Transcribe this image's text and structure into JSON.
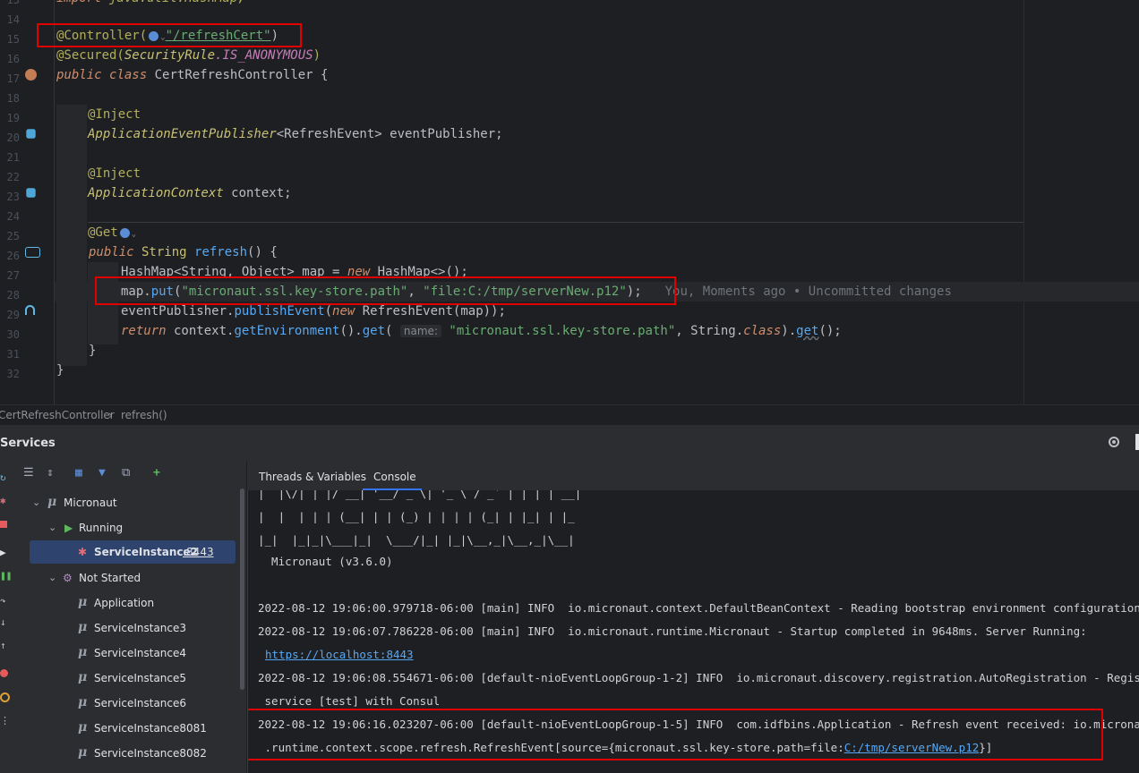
{
  "editor": {
    "line_numbers": [
      "13",
      "14",
      "15",
      "16",
      "17",
      "18",
      "19",
      "20",
      "21",
      "22",
      "23",
      "24",
      "25",
      "26",
      "27",
      "28",
      "29",
      "30",
      "31",
      "32"
    ],
    "top_partial": "import java.util.HashMap;",
    "l14_annotation": "@Controller(",
    "l14_path": "\"/refreshCert\"",
    "l14_close": ")",
    "l15_annotation": "@Secured(",
    "l15_rule": "SecurityRule",
    "l15_const": ".IS_ANONYMOUS",
    "l15_close": ")",
    "l16_public": "public",
    "l16_class": "class",
    "l16_name": "CertRefreshController {",
    "l18": "@Inject",
    "l19_type": "ApplicationEventPublisher",
    "l19_generic": "<RefreshEvent>",
    "l19_field": " eventPublisher;",
    "l21": "@Inject",
    "l22_type": "ApplicationContext",
    "l22_field": " context;",
    "l24": "@Get",
    "l25_public": "public",
    "l25_type": " String ",
    "l25_method": "refresh",
    "l25_rest": "() {",
    "l26_type": "HashMap<String, Object>",
    "l26_var": " map = ",
    "l26_new": "new",
    "l26_ctor": " HashMap",
    "l26_rest": "<>();",
    "l27_map": "map.",
    "l27_put": "put",
    "l27_key": "\"micronaut.ssl.key-store.path\"",
    "l27_sep": ", ",
    "l27_val": "\"file:C:/tmp/serverNew.p12\"",
    "l27_end": ");",
    "l27_blame": "You, Moments ago • Uncommitted changes",
    "l28_obj": "eventPublisher.",
    "l28_method": "publishEvent",
    "l28_open": "(",
    "l28_new": "new",
    "l28_rest": " RefreshEvent(map));",
    "l29_return": "return",
    "l29_ctx": " context.",
    "l29_getenv": "getEnvironment",
    "l29_mid": "().",
    "l29_get": "get",
    "l29_open": "( ",
    "l29_hint": "name:",
    "l29_key": " \"micronaut.ssl.key-store.path\"",
    "l29_sep": ", String.",
    "l29_class": "class",
    "l29_dot": ").",
    "l29_get2": "get",
    "l29_end": "();",
    "l30": "}",
    "l31": "}"
  },
  "breadcrumb": {
    "class_name": "CertRefreshController",
    "separator": "›",
    "method": "refresh()"
  },
  "services": {
    "title": "Services",
    "tree": {
      "micronaut": "Micronaut",
      "running": "Running",
      "selected_instance": "ServiceInstance2",
      "selected_port": ":8443",
      "not_started": "Not Started",
      "instances": [
        "Application",
        "ServiceInstance3",
        "ServiceInstance4",
        "ServiceInstance5",
        "ServiceInstance6",
        "ServiceInstance8081",
        "ServiceInstance8082"
      ]
    }
  },
  "console": {
    "tabs": [
      "Threads & Variables",
      "Console"
    ],
    "active_tab": "Console",
    "banner": [
      "|  |\\/| | |/ __| '__/ _ \\| '_ \\ / _` | | | | __|",
      "|  |  | | | (__| | | (_) | | | | (_| | |_| | |_",
      "|_|  |_|_|\\___|_|  \\___/|_| |_|\\__,_|\\__,_|\\__|"
    ],
    "version": "  Micronaut (v3.6.0)",
    "log1": "2022-08-12 19:06:00.979718-06:00 [main] INFO  io.micronaut.context.DefaultBeanContext - Reading bootstrap environment configuration",
    "log2": "2022-08-12 19:06:07.786228-06:00 [main] INFO  io.micronaut.runtime.Micronaut - Startup completed in 9648ms. Server Running:",
    "log2_link": "https://localhost:8443",
    "log3": "2022-08-12 19:06:08.554671-06:00 [default-nioEventLoopGroup-1-2] INFO  io.micronaut.discovery.registration.AutoRegistration - Registered",
    "log3_cont": " service [test] with Consul",
    "log4": "2022-08-12 19:06:16.023207-06:00 [default-nioEventLoopGroup-1-5] INFO  com.idfbins.Application - Refresh event received: io.micronaut",
    "log4_cont": " .runtime.context.scope.refresh.RefreshEvent[source={micronaut.ssl.key-store.path=file:",
    "log4_link": "C:/tmp/serverNew.p12",
    "log4_end": "}]"
  },
  "colors": {
    "highlight_box": "#e00000",
    "selection": "#2e436e",
    "link": "#56a8f5"
  }
}
